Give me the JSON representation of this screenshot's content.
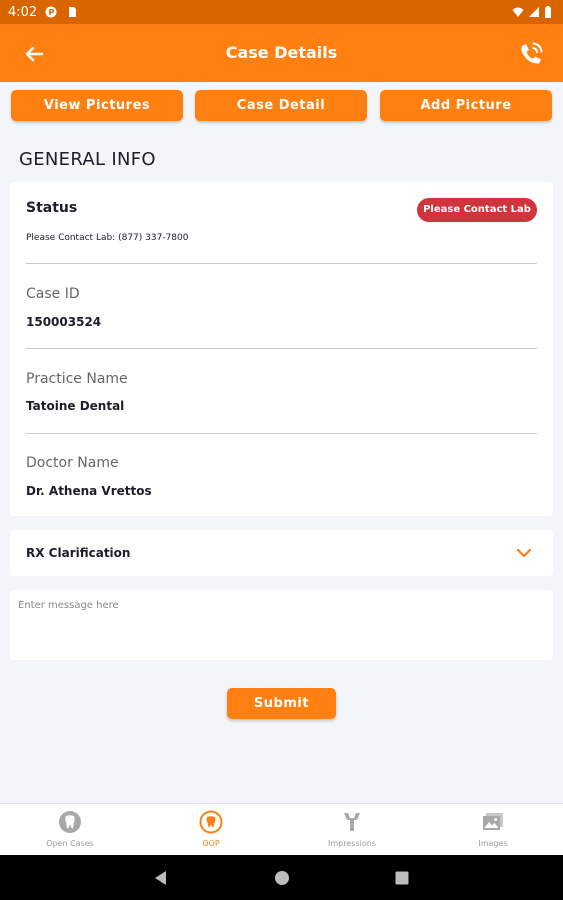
{
  "status_bar": {
    "time": "4:02"
  },
  "app_bar": {
    "title": "Case Details"
  },
  "tabs": [
    {
      "label": "View Pictures"
    },
    {
      "label": "Case Detail"
    },
    {
      "label": "Add Picture"
    }
  ],
  "general_info": {
    "heading": "GENERAL INFO",
    "status": {
      "label": "Status",
      "contact_text": "Please Contact Lab:  (877) 337-7800",
      "badge": "Please Contact Lab",
      "badge_color": "#d0343d"
    },
    "fields": [
      {
        "label": "Case ID",
        "value": "150003524"
      },
      {
        "label": "Practice Name",
        "value": "Tatoine Dental"
      },
      {
        "label": "Doctor Name",
        "value": "Dr. Athena Vrettos"
      }
    ]
  },
  "rx_clarification": {
    "label": "RX Clarification"
  },
  "message": {
    "placeholder": "Enter message here",
    "value": ""
  },
  "submit": {
    "label": "Submit"
  },
  "bottom_nav": [
    {
      "label": "Open Cases",
      "icon": "tooth-icon",
      "active": false
    },
    {
      "label": "OOP",
      "icon": "oop-icon",
      "active": true
    },
    {
      "label": "Impressions",
      "icon": "impressions-icon",
      "active": false
    },
    {
      "label": "Images",
      "icon": "images-icon",
      "active": false
    }
  ],
  "colors": {
    "accent": "#ff7f11",
    "status_bar": "#d96500",
    "badge": "#d0343d"
  }
}
